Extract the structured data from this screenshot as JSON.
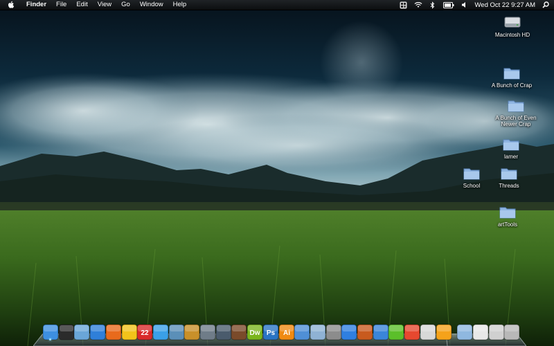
{
  "menubar": {
    "app_name": "Finder",
    "items": [
      "File",
      "Edit",
      "View",
      "Go",
      "Window",
      "Help"
    ],
    "status_icons": [
      "spaces-icon",
      "wifi-icon",
      "bluetooth-icon",
      "battery-icon",
      "volume-icon"
    ],
    "clock": "Wed Oct 22  9:27 AM"
  },
  "desktop_icons": [
    {
      "label": "Macintosh HD",
      "icon": "hard-drive-icon"
    },
    {
      "label": "A Bunch of Crap",
      "icon": "folder-icon"
    },
    {
      "label": "A Bunch of Even Newer Crap",
      "icon": "folder-icon"
    },
    {
      "label": "lamer",
      "icon": "folder-icon"
    },
    {
      "label": "School",
      "icon": "folder-icon"
    },
    {
      "label": "Threads",
      "icon": "folder-icon"
    },
    {
      "label": "artTools",
      "icon": "folder-icon"
    }
  ],
  "dock": {
    "apps": [
      {
        "icon": "finder-icon",
        "color": "#3d8fe0",
        "running": true
      },
      {
        "icon": "dashboard-icon",
        "color": "#2b2b2b",
        "running": false
      },
      {
        "icon": "preview-icon",
        "color": "#6aa6d8",
        "running": false
      },
      {
        "icon": "safari-icon",
        "color": "#2f7fd9",
        "running": false
      },
      {
        "icon": "firefox-icon",
        "color": "#e86a1c",
        "running": false
      },
      {
        "icon": "adium-icon",
        "color": "#f2c31a",
        "running": false
      },
      {
        "icon": "ical-icon",
        "color": "#d92a2a",
        "text": "22",
        "running": false
      },
      {
        "icon": "itunes-icon",
        "color": "#3aa0e8",
        "running": false
      },
      {
        "icon": "iphoto-icon",
        "color": "#5b8fb8",
        "running": false
      },
      {
        "icon": "garageband-icon",
        "color": "#c8902a",
        "running": false
      },
      {
        "icon": "photo-app-icon",
        "color": "#6f7c88",
        "running": false
      },
      {
        "icon": "spaces-grid-icon",
        "color": "#4a5b6c",
        "running": false
      },
      {
        "icon": "brush-app-icon",
        "color": "#7a4a2a",
        "running": false
      },
      {
        "icon": "dreamweaver-icon",
        "color": "#7ab51d",
        "text": "Dw",
        "running": false
      },
      {
        "icon": "photoshop-icon",
        "color": "#2a74c4",
        "text": "Ps",
        "running": false
      },
      {
        "icon": "illustrator-icon",
        "color": "#f08a12",
        "text": "Ai",
        "running": false
      },
      {
        "icon": "text-editor-icon",
        "color": "#4f8fd6",
        "running": false
      },
      {
        "icon": "ftp-client-icon",
        "color": "#8fb2d4",
        "running": false
      },
      {
        "icon": "sysprefs-icon",
        "color": "#8c8c8c",
        "running": false
      },
      {
        "icon": "textwrangler-icon",
        "color": "#2f7fe0",
        "running": false
      },
      {
        "icon": "bug-app-icon",
        "color": "#c85a1e",
        "running": false
      },
      {
        "icon": "gear-globe-icon",
        "color": "#3a85d9",
        "running": false
      },
      {
        "icon": "network-tool-icon",
        "color": "#5bbf2a",
        "running": false
      },
      {
        "icon": "colored-pencil-icon",
        "color": "#e6482f",
        "running": false
      },
      {
        "icon": "rocket-icon",
        "color": "#d8d8d8",
        "running": false
      },
      {
        "icon": "chain-link-icon",
        "color": "#f5a21a",
        "running": false
      },
      {
        "icon": "applications-folder-icon",
        "color": "#8fb8e0",
        "running": false
      },
      {
        "icon": "document-icon",
        "color": "#e8e8e8",
        "running": false
      },
      {
        "icon": "mail-stack-icon",
        "color": "#d0d0d0",
        "running": false
      },
      {
        "icon": "trash-icon",
        "color": "#b8b8b8",
        "running": false
      }
    ]
  },
  "colors": {
    "menubar_bg": "#111417",
    "sky_dark": "#06121b",
    "sky_mid": "#12394e",
    "grass": "#3d6a1e",
    "folder_blue": "#8fb5e2"
  }
}
